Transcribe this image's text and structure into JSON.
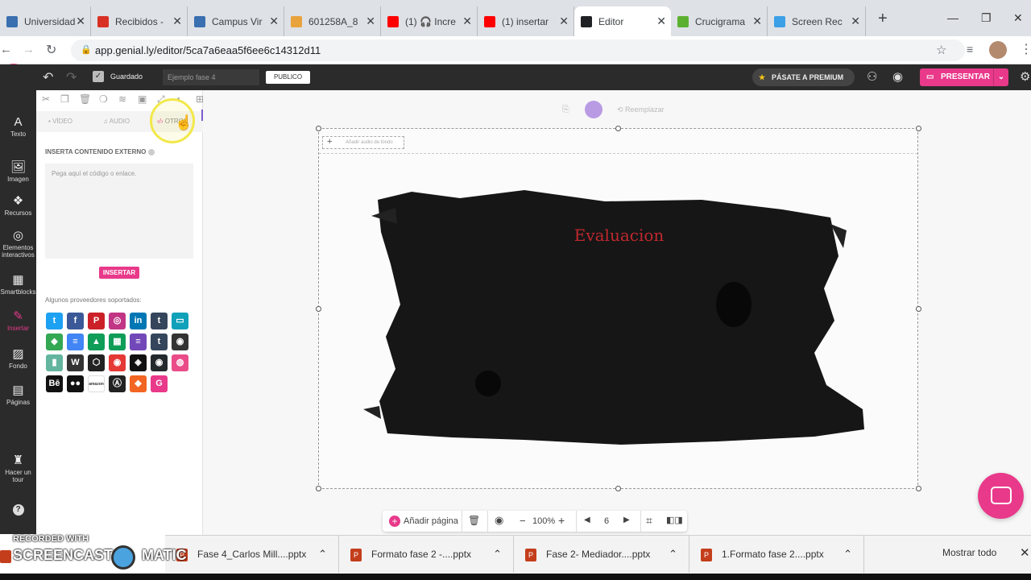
{
  "browser": {
    "tabs": [
      {
        "title": "Universidad",
        "color": "#3a6fb0"
      },
      {
        "title": "Recibidos -",
        "color": "#d93025"
      },
      {
        "title": "Campus Vir",
        "color": "#3a6fb0"
      },
      {
        "title": "601258A_8",
        "color": "#e8a33c"
      },
      {
        "title": "(1) 🎧 Incre",
        "color": "#ff0000"
      },
      {
        "title": "(1) insertar",
        "color": "#ff0000"
      },
      {
        "title": "Editor",
        "color": "#202124"
      },
      {
        "title": "Crucigrama",
        "color": "#5bb12f"
      },
      {
        "title": "Screen Rec",
        "color": "#3ba0e6"
      }
    ],
    "new_tab": "+",
    "url": "app.genial.ly/editor/5ca7a6eaa5f6ee6c14312d11"
  },
  "editor": {
    "saved_label": "Guardado",
    "project_name": "Ejemplo fase 4",
    "visibility": "PUBLICO",
    "premium_label": "PÁSATE A PREMIUM",
    "present_label": "PRESENTAR"
  },
  "rail": [
    {
      "label": "Texto",
      "icon": "A"
    },
    {
      "label": "Imagen",
      "icon": "🖼"
    },
    {
      "label": "Recursos",
      "icon": "❖"
    },
    {
      "label": "Elementos interactivos",
      "icon": "◎"
    },
    {
      "label": "Smartblocks",
      "icon": "▦"
    },
    {
      "label": "Insertar",
      "icon": "✎"
    },
    {
      "label": "Fondo",
      "icon": "▨"
    },
    {
      "label": "Páginas",
      "icon": "▤"
    },
    {
      "label": "Hacer un tour",
      "icon": "♜"
    },
    {
      "label": "?",
      "icon": ""
    }
  ],
  "panel": {
    "tabs": [
      "VÍDEO",
      "AUDIO",
      "OTROS"
    ],
    "section_title": "INSERTA CONTENIDO EXTERNO",
    "embed_placeholder": "Pega aquí el código o enlace.",
    "insert_button": "INSERTAR",
    "providers_title": "Algunos proveedores soportados:",
    "providers": [
      {
        "icon": "twitter-icon",
        "glyph": "t",
        "color": "#1da1f2"
      },
      {
        "icon": "facebook-icon",
        "glyph": "f",
        "color": "#3b5998"
      },
      {
        "icon": "pinterest-icon",
        "glyph": "P",
        "color": "#cb2027"
      },
      {
        "icon": "instagram-icon",
        "glyph": "◎",
        "color": "#c13584"
      },
      {
        "icon": "linkedin-icon",
        "glyph": "in",
        "color": "#0077b5"
      },
      {
        "icon": "tumblr-icon",
        "glyph": "t",
        "color": "#35465c"
      },
      {
        "icon": "slideshare-icon",
        "glyph": "▭",
        "color": "#0fa1b9"
      },
      {
        "icon": "google-maps-icon",
        "glyph": "◆",
        "color": "#34a853"
      },
      {
        "icon": "google-docs-icon",
        "glyph": "≡",
        "color": "#4285f4"
      },
      {
        "icon": "google-drive-icon",
        "glyph": "▲",
        "color": "#0f9d58"
      },
      {
        "icon": "google-sheets-icon",
        "glyph": "▦",
        "color": "#0f9d58"
      },
      {
        "icon": "google-forms-icon",
        "glyph": "≡",
        "color": "#7248b9"
      },
      {
        "icon": "tumblr-dark-icon",
        "glyph": "t",
        "color": "#35465c"
      },
      {
        "icon": "github-alt-icon",
        "glyph": "◉",
        "color": "#333333"
      },
      {
        "icon": "chart-icon",
        "glyph": "▮",
        "color": "#64b5a0"
      },
      {
        "icon": "wikipedia-icon",
        "glyph": "W",
        "color": "#333333"
      },
      {
        "icon": "codepen-icon",
        "glyph": "⬡",
        "color": "#222222"
      },
      {
        "icon": "flipsnack-icon",
        "glyph": "◉",
        "color": "#e53935"
      },
      {
        "icon": "codesandbox-icon",
        "glyph": "◈",
        "color": "#111111"
      },
      {
        "icon": "github-icon",
        "glyph": "◉",
        "color": "#24292e"
      },
      {
        "icon": "dribbble-icon",
        "glyph": "◍",
        "color": "#ea4c89"
      },
      {
        "icon": "behance-icon",
        "glyph": "Bē",
        "color": "#111111"
      },
      {
        "icon": "flickr-icon",
        "glyph": "●●",
        "color": "#111111"
      },
      {
        "icon": "amazon-icon",
        "glyph": "amazon",
        "color": "#ffffff"
      },
      {
        "icon": "dibujo-icon",
        "glyph": "Ⓐ",
        "color": "#222222"
      },
      {
        "icon": "sketchfab-icon",
        "glyph": "◆",
        "color": "#f26522"
      },
      {
        "icon": "genially-icon",
        "glyph": "G",
        "color": "#e8398a"
      }
    ]
  },
  "slide": {
    "title": "Evaluacion",
    "title_color": "#c0282f",
    "audio_hint": "Añadir audio de fondo",
    "replace_label": "Reemplazar"
  },
  "bottombar": {
    "add_page": "Añadir página",
    "zoom": "100%",
    "page": "6"
  },
  "taskbar": {
    "recorder_top": "RECORDED WITH",
    "recorder_name": "SCREENCAST",
    "recorder_suffix": "MATIC",
    "files": [
      "Fase 4_Carlos Mill....pptx",
      "Formato fase 2 -....pptx",
      "Fase 2- Mediador....pptx",
      "1.Formato fase 2....pptx"
    ],
    "show_all": "Mostrar todo"
  }
}
